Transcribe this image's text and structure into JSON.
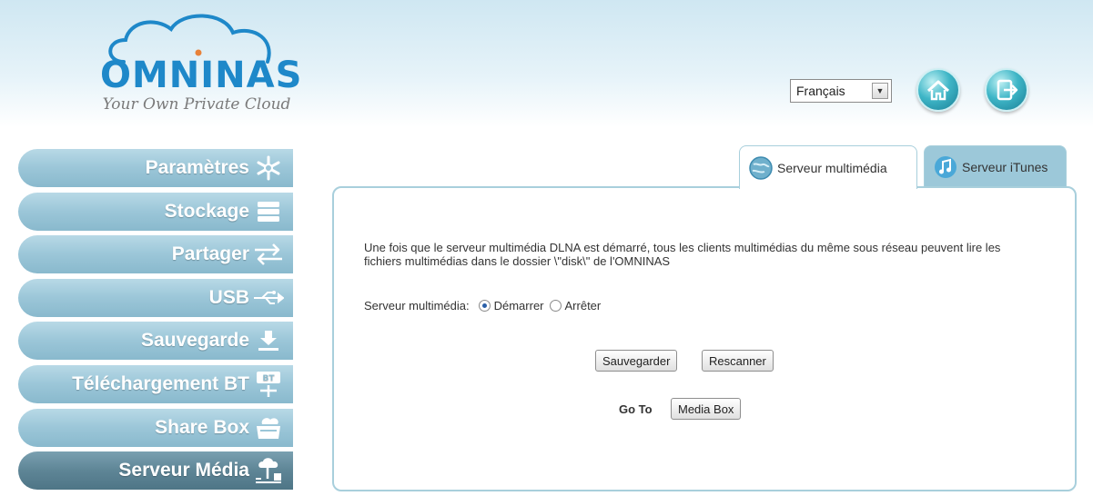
{
  "logo": {
    "word": "OMNINAS",
    "tagline": "Your Own Private Cloud"
  },
  "header": {
    "language": "Français"
  },
  "sidebar": {
    "items": [
      {
        "label": "Paramètres"
      },
      {
        "label": "Stockage"
      },
      {
        "label": "Partager"
      },
      {
        "label": "USB"
      },
      {
        "label": "Sauvegarde"
      },
      {
        "label": "Téléchargement BT"
      },
      {
        "label": "Share Box"
      },
      {
        "label": "Serveur Média"
      }
    ],
    "bt_badge": "BT"
  },
  "tabs": [
    {
      "label": "Serveur multimédia"
    },
    {
      "label": "Serveur iTunes"
    }
  ],
  "panel": {
    "description": "Une fois que le serveur multimédia DLNA est démarré, tous les clients multimédias du même sous réseau peuvent lire les fichiers multimédias dans le dossier \\\"disk\\\" de l'OMNINAS",
    "radio_label": "Serveur multimédia:",
    "radio_options": [
      "Démarrer",
      "Arrêter"
    ],
    "save_label": "Sauvegarder",
    "rescan_label": "Rescanner",
    "goto_label": "Go To",
    "mediabox_label": "Media Box"
  },
  "colors": {
    "accent": "#1e88c9",
    "sidebar": "#9bc6d8",
    "sidebar_active": "#5e8596",
    "panel_border": "#a8cfdc"
  }
}
